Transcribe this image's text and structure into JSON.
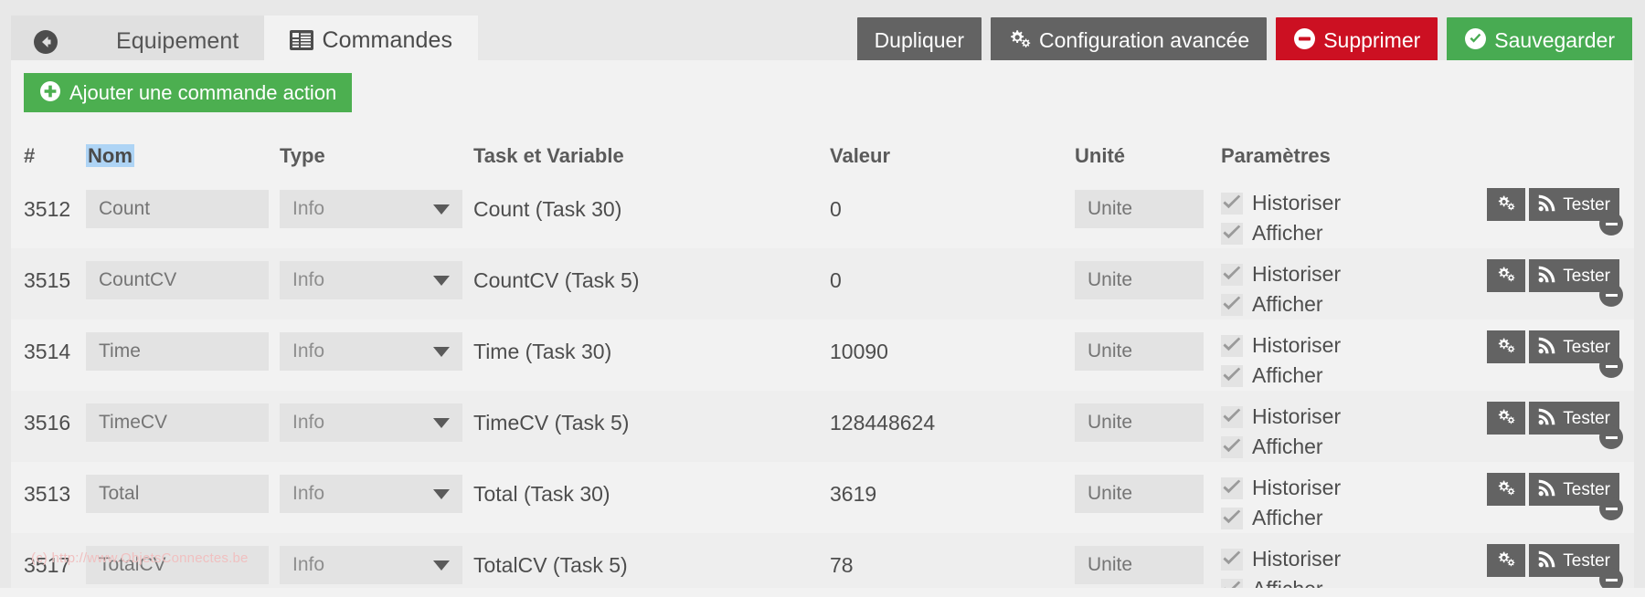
{
  "tabs": [
    {
      "id": "back",
      "label": "",
      "icon": "arrow-left-circle-icon",
      "active": false
    },
    {
      "id": "equipement",
      "label": "Equipement",
      "icon": "",
      "active": false
    },
    {
      "id": "commandes",
      "label": "Commandes",
      "icon": "table-icon",
      "active": true
    }
  ],
  "top_actions": [
    {
      "id": "dupliquer",
      "label": "Dupliquer",
      "icon": "",
      "style": "grey"
    },
    {
      "id": "config",
      "label": "Configuration avancée",
      "icon": "cogs-icon",
      "style": "grey"
    },
    {
      "id": "supprimer",
      "label": "Supprimer",
      "icon": "minus-circle-icon",
      "style": "red"
    },
    {
      "id": "sauvegarder",
      "label": "Sauvegarder",
      "icon": "check-circle-icon",
      "style": "green"
    }
  ],
  "add_button": {
    "label": "Ajouter une commande action",
    "icon": "plus-circle-icon"
  },
  "table": {
    "headers": {
      "id": "#",
      "nom": "Nom",
      "type": "Type",
      "task": "Task et Variable",
      "valeur": "Valeur",
      "unite": "Unité",
      "parametres": "Paramètres",
      "actions": ""
    },
    "nom_header_highlighted": true,
    "unit_placeholder": "Unite",
    "param_labels": {
      "historiser": "Historiser",
      "afficher": "Afficher"
    },
    "row_actions": {
      "config_icon": "cogs-icon",
      "test_label": "Tester",
      "test_icon": "rss-icon",
      "remove_icon": "minus-circle-icon"
    },
    "rows": [
      {
        "id": "3512",
        "nom": "Count",
        "type": "Info",
        "task": "Count (Task 30)",
        "valeur": "0",
        "unite": "",
        "historiser": true,
        "afficher": true
      },
      {
        "id": "3515",
        "nom": "CountCV",
        "type": "Info",
        "task": "CountCV (Task 5)",
        "valeur": "0",
        "unite": "",
        "historiser": true,
        "afficher": true
      },
      {
        "id": "3514",
        "nom": "Time",
        "type": "Info",
        "task": "Time (Task 30)",
        "valeur": "10090",
        "unite": "",
        "historiser": true,
        "afficher": true
      },
      {
        "id": "3516",
        "nom": "TimeCV",
        "type": "Info",
        "task": "TimeCV (Task 5)",
        "valeur": "128448624",
        "unite": "",
        "historiser": true,
        "afficher": true
      },
      {
        "id": "3513",
        "nom": "Total",
        "type": "Info",
        "task": "Total (Task 30)",
        "valeur": "3619",
        "unite": "",
        "historiser": true,
        "afficher": true
      },
      {
        "id": "3517",
        "nom": "TotalCV",
        "type": "Info",
        "task": "TotalCV (Task 5)",
        "valeur": "78",
        "unite": "",
        "historiser": true,
        "afficher": true
      }
    ]
  },
  "watermark": "(c) http://www.ObjetsConnectes.be",
  "colors": {
    "accent_green": "#8bc220",
    "button_green": "#48ab52",
    "button_red": "#cc1022",
    "button_grey": "#636363",
    "add_green": "#4caf50",
    "highlight_blue": "#aed4f5",
    "watermark_pink": "#f0c0c0"
  }
}
